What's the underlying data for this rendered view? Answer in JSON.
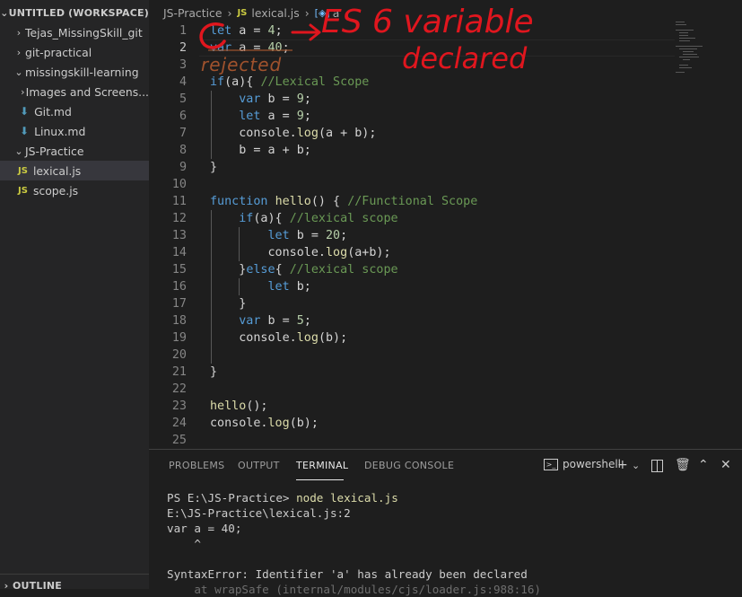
{
  "sidebar": {
    "workspace_title": "UNTITLED (WORKSPACE)",
    "outline_title": "OUTLINE",
    "items": [
      {
        "label": "Tejas_MissingSkill_git",
        "type": "folder"
      },
      {
        "label": "git-practical",
        "type": "folder"
      },
      {
        "label": "missingskill-learning",
        "type": "folder-open"
      },
      {
        "label": "Images and Screens...",
        "type": "folder"
      },
      {
        "label": "Git.md",
        "type": "md"
      },
      {
        "label": "Linux.md",
        "type": "md"
      },
      {
        "label": "JS-Practice",
        "type": "folder-open"
      },
      {
        "label": "lexical.js",
        "type": "js"
      },
      {
        "label": "scope.js",
        "type": "js"
      }
    ],
    "file_badge": "JS"
  },
  "breadcrumb": {
    "folder": "JS-Practice",
    "file": "lexical.js",
    "symbol": "a"
  },
  "editor": {
    "line_numbers": [
      "1",
      "2",
      "3",
      "4",
      "5",
      "6",
      "7",
      "8",
      "9",
      "10",
      "11",
      "12",
      "13",
      "14",
      "15",
      "16",
      "17",
      "18",
      "19",
      "20",
      "21",
      "22",
      "23",
      "24",
      "25"
    ],
    "active_line": 2
  },
  "annotations": {
    "es6_text": "ES 6 variable",
    "declared_text": "declared",
    "rejected_text": "rejected"
  },
  "panel": {
    "tabs": [
      "PROBLEMS",
      "OUTPUT",
      "TERMINAL",
      "DEBUG CONSOLE"
    ],
    "active_tab": "TERMINAL",
    "shell_name": "powershell",
    "terminal": {
      "prompt": "PS E:\\JS-Practice> ",
      "command": "node lexical.js",
      "lines": [
        "E:\\JS-Practice\\lexical.js:2",
        "var a = 40;",
        "    ^",
        "",
        "SyntaxError: Identifier 'a' has already been declared",
        "    at wrapSafe (internal/modules/cjs/loader.js:988:16)"
      ]
    }
  },
  "colors": {
    "keyword": "#569cd6",
    "comment": "#6a9955",
    "number": "#b5cea8",
    "function": "#dcdcaa",
    "annotation_red": "#e0161e",
    "annotation_brown": "#a0522d"
  }
}
